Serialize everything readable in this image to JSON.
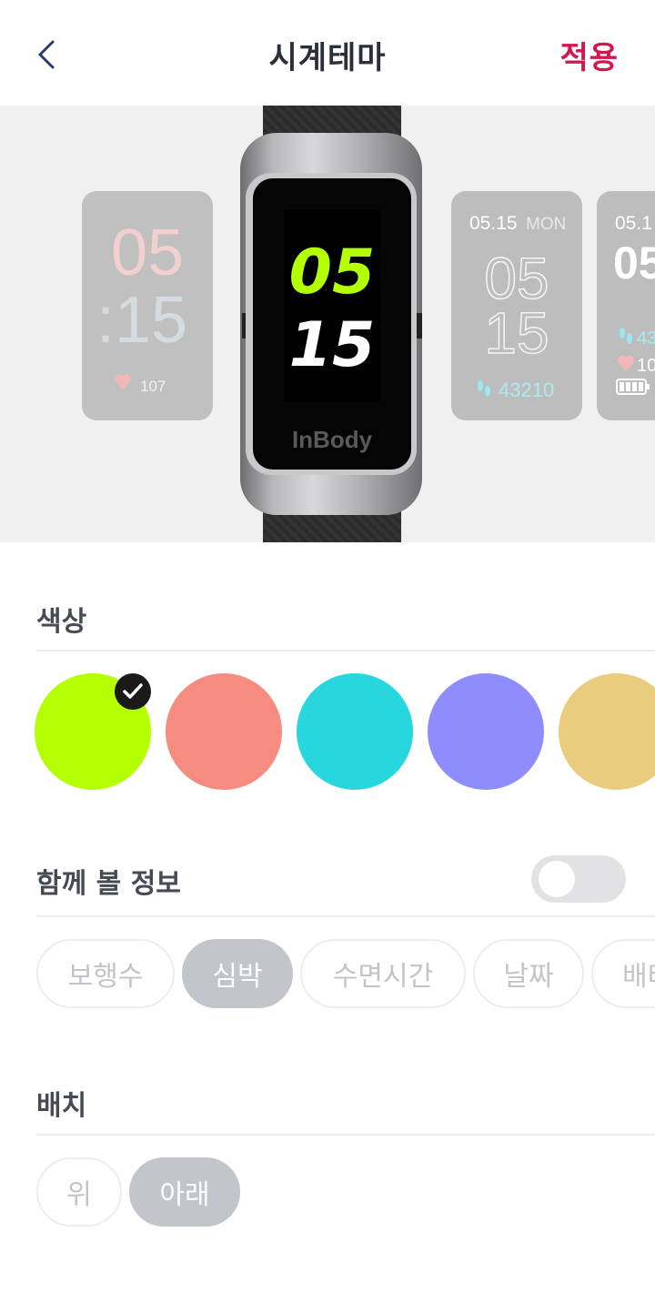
{
  "header": {
    "title": "시계테마",
    "apply_label": "적용"
  },
  "preview": {
    "center": {
      "hour": "05",
      "minute": "15",
      "brand": "InBody"
    },
    "mini_left": {
      "hour": "05",
      "minute": ":15",
      "heart_rate": "107"
    },
    "mini_right_1": {
      "date": "05.15",
      "day": "MON",
      "hour": "05",
      "minute": "15",
      "steps": "43210"
    },
    "mini_right_2": {
      "date": "05.1",
      "hour": "05",
      "steps": "43",
      "heart_rate": "10"
    }
  },
  "color_section": {
    "label": "색상",
    "swatches": [
      "#b4ff04",
      "#f68b7f",
      "#28d6de",
      "#8e8cff",
      "#e9cc7e"
    ],
    "selected_index": 0
  },
  "info_section": {
    "label": "함께 볼 정보",
    "toggle_on": false,
    "chips": [
      "보행수",
      "심박",
      "수면시간",
      "날짜",
      "배터"
    ],
    "selected": "심박"
  },
  "layout_section": {
    "label": "배치",
    "options": [
      "위",
      "아래"
    ],
    "selected": "아래"
  }
}
